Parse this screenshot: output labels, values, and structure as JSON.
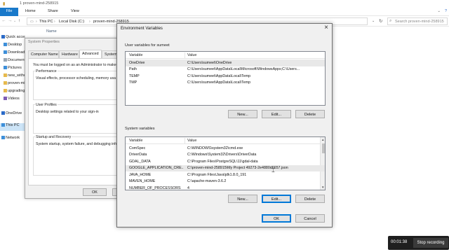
{
  "explorer": {
    "title": "1 proven-mind-258915",
    "ribbon_tabs": [
      "File",
      "Home",
      "Share",
      "View"
    ],
    "breadcrumb": [
      "This PC",
      "Local Disk (C:)",
      "proven-mind-258915"
    ],
    "search_placeholder": "Search proven-mind-258915",
    "column_name": "Name",
    "sidebar": [
      {
        "label": "Quick access",
        "icon": "star-icon",
        "color": "#2a6ac8"
      },
      {
        "label": "Desktop",
        "icon": "desktop-icon",
        "color": "#3d8fd9"
      },
      {
        "label": "Downloads",
        "icon": "download-icon",
        "color": "#3d8fd9"
      },
      {
        "label": "Documents",
        "icon": "document-icon",
        "color": "#9aa6b2"
      },
      {
        "label": "Pictures",
        "icon": "pictures-icon",
        "color": "#3d8fd9"
      },
      {
        "label": "new_witho",
        "icon": "folder-icon",
        "color": "#e6b94c"
      },
      {
        "label": "proven-mi",
        "icon": "folder-icon",
        "color": "#e6b94c"
      },
      {
        "label": "upgrading",
        "icon": "folder-icon",
        "color": "#e6b94c"
      },
      {
        "label": "Videos",
        "icon": "video-icon",
        "color": "#7d5bb5"
      },
      {
        "label": "OneDrive",
        "icon": "cloud-icon",
        "color": "#2a6ac8"
      },
      {
        "label": "This PC",
        "icon": "computer-icon",
        "color": "#3d8fd9"
      },
      {
        "label": "Network",
        "icon": "network-icon",
        "color": "#3d8fd9"
      }
    ]
  },
  "system_properties": {
    "title": "System Properties",
    "tabs": [
      "Computer Name",
      "Hardware",
      "Advanced",
      "System Pr"
    ],
    "admin_note": "You must be logged on as an Administrator to make",
    "performance_label": "Performance",
    "performance_desc": "Visual effects, processor scheduling, memory usa",
    "user_profiles_label": "User Profiles",
    "user_profiles_desc": "Desktop settings related to your sign-in",
    "startup_label": "Startup and Recovery",
    "startup_desc": "System startup, system failure, and debugging info",
    "ok_label": "OK"
  },
  "env_dialog": {
    "title": "Environment Variables",
    "user_section_label": "User variables for sumeet",
    "system_section_label": "System variables",
    "col_variable": "Variable",
    "col_value": "Value",
    "user_vars": [
      {
        "name": "OneDrive",
        "value": "C:\\Users\\sumeet\\OneDrive"
      },
      {
        "name": "Path",
        "value": "C:\\Users\\sumeet\\AppData\\Local\\Microsoft\\WindowsApps;C:\\Users..."
      },
      {
        "name": "TEMP",
        "value": "C:\\Users\\sumeet\\AppData\\Local\\Temp"
      },
      {
        "name": "TMP",
        "value": "C:\\Users\\sumeet\\AppData\\Local\\Temp"
      }
    ],
    "system_vars": [
      {
        "name": "ComSpec",
        "value": "C:\\WINDOWS\\system32\\cmd.exe"
      },
      {
        "name": "DriverData",
        "value": "C:\\Windows\\System32\\Drivers\\DriverData"
      },
      {
        "name": "GDAL_DATA",
        "value": "C:\\Program Files\\PostgreSQL\\11\\gdal-data"
      },
      {
        "name": "GOOGLE_APPLICATION_CRE...",
        "value": "C:\\proven-mind-258915\\My Project 49273-2e4880d6657.json"
      },
      {
        "name": "JAVA_HOME",
        "value": "C:\\Program Files\\Java\\jdk1.8.0_191"
      },
      {
        "name": "MAVEN_HOME",
        "value": "C:\\apache-maven-3.6.2"
      },
      {
        "name": "NUMBER_OF_PROCESSORS",
        "value": "4"
      }
    ],
    "new_label": "New...",
    "edit_label": "Edit...",
    "delete_label": "Delete",
    "ok_label": "OK",
    "cancel_label": "Cancel"
  },
  "recorder": {
    "time": "00:01:38",
    "stop_label": "Stop recording"
  }
}
